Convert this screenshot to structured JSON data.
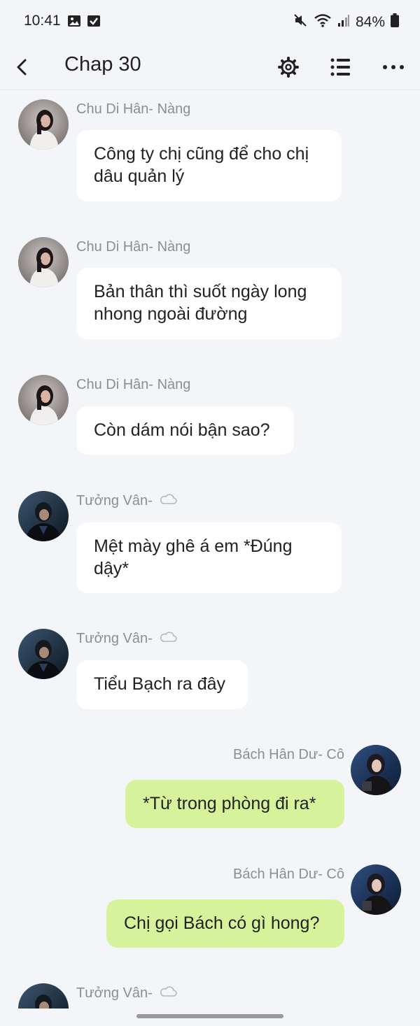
{
  "status": {
    "time": "10:41",
    "battery": "84%",
    "icons": [
      "image-icon",
      "check-box-icon",
      "mute-icon",
      "wifi-icon",
      "signal-icon",
      "battery-icon"
    ]
  },
  "appbar": {
    "title": "Chap 30",
    "icons": [
      "back-icon",
      "settings-icon",
      "list-icon",
      "more-icon"
    ]
  },
  "messages": [
    {
      "side": "left",
      "sender": "Chu Di Hân- Nàng",
      "text": "Công ty chị cũng để cho chị dâu quản lý",
      "avatar": "female-avatar"
    },
    {
      "side": "left",
      "sender": "Chu Di Hân- Nàng",
      "text": "Bản thân thì suốt ngày long nhong ngoài đường",
      "avatar": "female-avatar"
    },
    {
      "side": "left",
      "sender": "Chu Di Hân- Nàng",
      "text": "Còn dám nói bận sao?",
      "avatar": "female-avatar"
    },
    {
      "side": "left",
      "sender": "Tưởng Vân-",
      "sender_icon": "cloud-icon",
      "text": "Mệt mày ghê á em *Đúng dậy*",
      "avatar": "male-avatar"
    },
    {
      "side": "left",
      "sender": "Tưởng Vân-",
      "sender_icon": "cloud-icon",
      "text": "Tiểu Bạch ra đây",
      "avatar": "male-avatar"
    },
    {
      "side": "right",
      "sender": "Bách Hân Dư- Cô",
      "text": "*Từ trong phòng đi ra*",
      "avatar": "girl-avatar"
    },
    {
      "side": "right",
      "sender": "Bách Hân Dư- Cô",
      "text": "Chị gọi Bách có gì hong?",
      "avatar": "girl-avatar"
    },
    {
      "side": "left",
      "sender": "Tưởng Vân-",
      "sender_icon": "cloud-icon",
      "text": "",
      "avatar": "male-avatar"
    }
  ],
  "colors": {
    "background": "#f4f5f9",
    "left_bubble": "#ffffff",
    "right_bubble": "#d6f39b",
    "name_text": "#8c8e94"
  }
}
